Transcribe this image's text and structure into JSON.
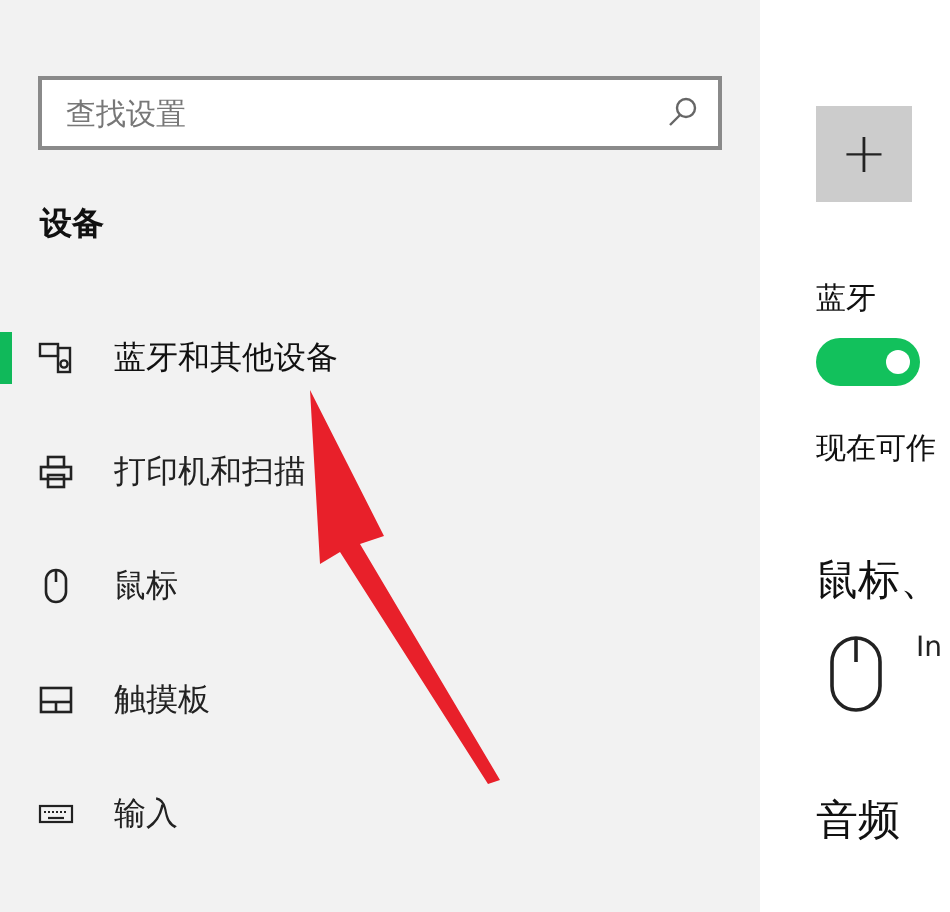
{
  "nav": {
    "search": {
      "placeholder": "查找设置"
    },
    "section": "设备",
    "items": [
      {
        "label": "蓝牙和其他设备",
        "selected": true
      },
      {
        "label": "打印机和扫描",
        "selected": false
      },
      {
        "label": "鼠标",
        "selected": false
      },
      {
        "label": "触摸板",
        "selected": false
      },
      {
        "label": "输入",
        "selected": false
      }
    ]
  },
  "content": {
    "add_button": "+",
    "bluetooth_label": "蓝牙",
    "bluetooth_toggle": {
      "on": true
    },
    "discoverable_text": "现在可作",
    "mouse_heading": "鼠标、",
    "device_name": "In",
    "audio_heading": "音频"
  }
}
